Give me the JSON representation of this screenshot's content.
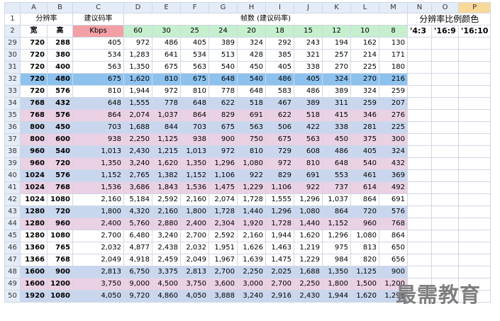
{
  "columns": [
    "A",
    "B",
    "C",
    "D",
    "E",
    "F",
    "G",
    "H",
    "I",
    "J",
    "K",
    "L",
    "M",
    "N",
    "O",
    "P"
  ],
  "header": {
    "row1_num": "1",
    "row2_num": "2",
    "resolution_label": "分辨率",
    "bitrate_label": "建议码率",
    "fps_label": "帧数 (建议码率)",
    "ratio_color_label": "分辨率比例颜色",
    "width_label": "宽",
    "height_label": "高",
    "kbps_label": "Kbps",
    "fps_values": [
      "60",
      "30",
      "25",
      "24",
      "20",
      "18",
      "15",
      "12",
      "10",
      "8"
    ],
    "ratios": [
      "'4:3",
      "'16:9",
      "'16:10"
    ]
  },
  "rows": [
    {
      "num": "29",
      "style": "white",
      "w": "720",
      "h": "288",
      "kbps": "405",
      "fps": [
        "972",
        "486",
        "405",
        "389",
        "324",
        "292",
        "243",
        "194",
        "162",
        "130"
      ]
    },
    {
      "num": "30",
      "style": "white",
      "w": "720",
      "h": "380",
      "kbps": "534",
      "fps": [
        "1,283",
        "641",
        "534",
        "513",
        "428",
        "385",
        "321",
        "257",
        "214",
        "171"
      ]
    },
    {
      "num": "31",
      "style": "white",
      "w": "720",
      "h": "400",
      "kbps": "563",
      "fps": [
        "1,350",
        "675",
        "563",
        "540",
        "450",
        "405",
        "338",
        "270",
        "225",
        "180"
      ]
    },
    {
      "num": "32",
      "style": "sel",
      "w": "720",
      "h": "480",
      "kbps": "675",
      "fps": [
        "1,620",
        "810",
        "675",
        "648",
        "540",
        "486",
        "405",
        "324",
        "270",
        "216"
      ]
    },
    {
      "num": "33",
      "style": "white",
      "w": "720",
      "h": "576",
      "kbps": "810",
      "fps": [
        "1,944",
        "972",
        "810",
        "778",
        "648",
        "583",
        "486",
        "389",
        "324",
        "259"
      ]
    },
    {
      "num": "34",
      "style": "blue",
      "w": "768",
      "h": "432",
      "kbps": "648",
      "fps": [
        "1,555",
        "778",
        "648",
        "622",
        "518",
        "467",
        "389",
        "311",
        "259",
        "207"
      ]
    },
    {
      "num": "35",
      "style": "pink",
      "w": "768",
      "h": "576",
      "kbps": "864",
      "fps": [
        "2,074",
        "1,037",
        "864",
        "829",
        "691",
        "622",
        "518",
        "415",
        "346",
        "276"
      ]
    },
    {
      "num": "36",
      "style": "blue",
      "w": "800",
      "h": "450",
      "kbps": "703",
      "fps": [
        "1,688",
        "844",
        "703",
        "675",
        "563",
        "506",
        "422",
        "338",
        "281",
        "225"
      ]
    },
    {
      "num": "37",
      "style": "pink",
      "w": "800",
      "h": "600",
      "kbps": "938",
      "fps": [
        "2,250",
        "1,125",
        "938",
        "900",
        "750",
        "675",
        "563",
        "450",
        "375",
        "300"
      ]
    },
    {
      "num": "38",
      "style": "blue",
      "w": "960",
      "h": "540",
      "kbps": "1,013",
      "fps": [
        "2,430",
        "1,215",
        "1,013",
        "972",
        "810",
        "729",
        "608",
        "486",
        "405",
        "324"
      ]
    },
    {
      "num": "39",
      "style": "pink",
      "w": "960",
      "h": "720",
      "kbps": "1,350",
      "fps": [
        "3,240",
        "1,620",
        "1,350",
        "1,296",
        "1,080",
        "972",
        "810",
        "648",
        "540",
        "432"
      ]
    },
    {
      "num": "40",
      "style": "blue",
      "w": "1024",
      "h": "576",
      "kbps": "1,152",
      "fps": [
        "2,765",
        "1,382",
        "1,152",
        "1,106",
        "922",
        "829",
        "691",
        "553",
        "461",
        "369"
      ]
    },
    {
      "num": "41",
      "style": "pink",
      "w": "1024",
      "h": "768",
      "kbps": "1,536",
      "fps": [
        "3,686",
        "1,843",
        "1,536",
        "1,475",
        "1,229",
        "1,106",
        "922",
        "737",
        "614",
        "492"
      ]
    },
    {
      "num": "42",
      "style": "white",
      "w": "1024",
      "h": "1080",
      "kbps": "2,160",
      "fps": [
        "5,184",
        "2,592",
        "2,160",
        "2,074",
        "1,728",
        "1,555",
        "1,296",
        "1,037",
        "864",
        "691"
      ]
    },
    {
      "num": "43",
      "style": "blue",
      "w": "1280",
      "h": "720",
      "kbps": "1,800",
      "fps": [
        "4,320",
        "2,160",
        "1,800",
        "1,728",
        "1,440",
        "1,296",
        "1,080",
        "864",
        "720",
        "576"
      ]
    },
    {
      "num": "44",
      "style": "pink",
      "w": "1280",
      "h": "960",
      "kbps": "2,400",
      "fps": [
        "5,760",
        "2,880",
        "2,400",
        "2,304",
        "1,920",
        "1,728",
        "1,440",
        "1,152",
        "960",
        "768"
      ]
    },
    {
      "num": "45",
      "style": "white",
      "w": "1280",
      "h": "1080",
      "kbps": "2,700",
      "fps": [
        "6,480",
        "3,240",
        "2,700",
        "2,592",
        "2,160",
        "1,944",
        "1,620",
        "1,296",
        "1,080",
        "864"
      ]
    },
    {
      "num": "46",
      "style": "white",
      "w": "1360",
      "h": "765",
      "kbps": "2,032",
      "fps": [
        "4,877",
        "2,438",
        "2,032",
        "1,951",
        "1,626",
        "1,463",
        "1,219",
        "975",
        "813",
        "650"
      ]
    },
    {
      "num": "47",
      "style": "white",
      "w": "1366",
      "h": "768",
      "kbps": "2,049",
      "fps": [
        "4,918",
        "2,459",
        "2,049",
        "1,967",
        "1,639",
        "1,475",
        "1,229",
        "984",
        "820",
        "656"
      ]
    },
    {
      "num": "48",
      "style": "blue",
      "w": "1600",
      "h": "900",
      "kbps": "2,813",
      "fps": [
        "6,750",
        "3,375",
        "2,813",
        "2,700",
        "2,250",
        "2,025",
        "1,688",
        "1,350",
        "1,125",
        "900"
      ]
    },
    {
      "num": "49",
      "style": "pink",
      "w": "1600",
      "h": "1200",
      "kbps": "3,750",
      "fps": [
        "9,000",
        "4,500",
        "3,750",
        "3,600",
        "3,000",
        "2,700",
        "2,250",
        "1,800",
        "1,500",
        "1,200"
      ]
    },
    {
      "num": "50",
      "style": "blue",
      "w": "1920",
      "h": "1080",
      "kbps": "4,050",
      "fps": [
        "9,720",
        "4,860",
        "4,050",
        "3,888",
        "3,240",
        "2,916",
        "2,430",
        "1,944",
        "1,620",
        "1,296"
      ]
    }
  ],
  "watermark": "最需教育"
}
